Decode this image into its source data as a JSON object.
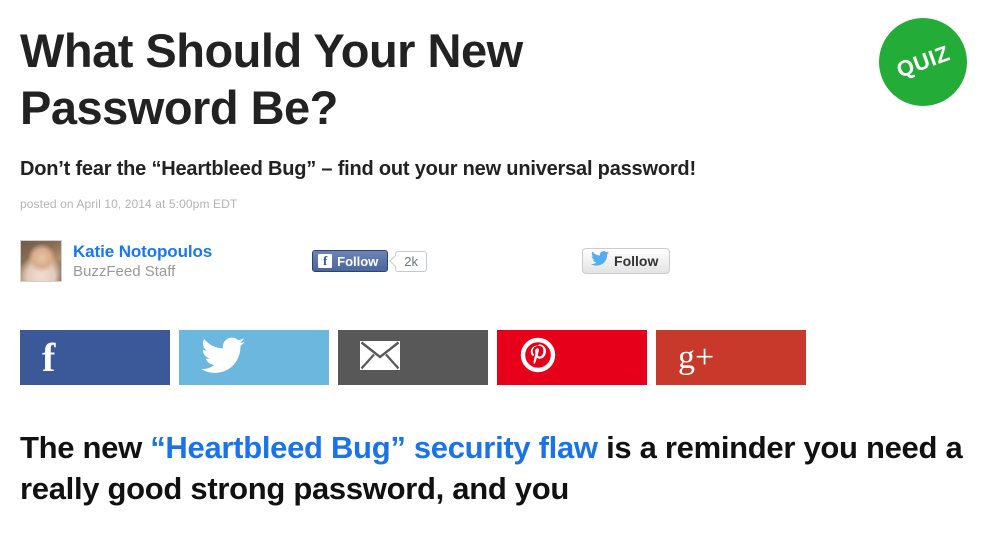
{
  "badge": {
    "label": "QUIZ",
    "color": "#23ac38"
  },
  "article": {
    "headline": "What Should Your New Password Be?",
    "subtitle": "Don’t fear the “Heartbleed Bug” – find out your new universal password!",
    "timestamp": "posted on April 10, 2014 at 5:00pm EDT"
  },
  "byline": {
    "author_name": "Katie Notopoulos",
    "author_role": "BuzzFeed Staff",
    "author_name_color": "#1878f3"
  },
  "follow": {
    "facebook": {
      "label": "Follow",
      "glyph": "f",
      "count": "2k",
      "color": "#3b5998"
    },
    "twitter": {
      "label": "Follow",
      "icon": "twitter-bird-icon",
      "color": "#55acee"
    }
  },
  "share_bar": {
    "buttons": [
      {
        "name": "facebook",
        "icon": "facebook-icon",
        "glyph": "f",
        "color": "#3b5998"
      },
      {
        "name": "twitter",
        "icon": "twitter-icon",
        "glyph": "",
        "color": "#6cb7dd"
      },
      {
        "name": "email",
        "icon": "envelope-icon",
        "glyph": "",
        "color": "#585858"
      },
      {
        "name": "pinterest",
        "icon": "pinterest-icon",
        "glyph": "",
        "color": "#e60019"
      },
      {
        "name": "googleplus",
        "icon": "google-plus-icon",
        "glyph": "g+",
        "color": "#c9392b"
      }
    ]
  },
  "body": {
    "lead_1": "The new ",
    "link_text": "“Heartbleed Bug” security flaw",
    "lead_2": " is a reminder you need a really good strong password, and you",
    "link_color": "#1a73e8"
  }
}
